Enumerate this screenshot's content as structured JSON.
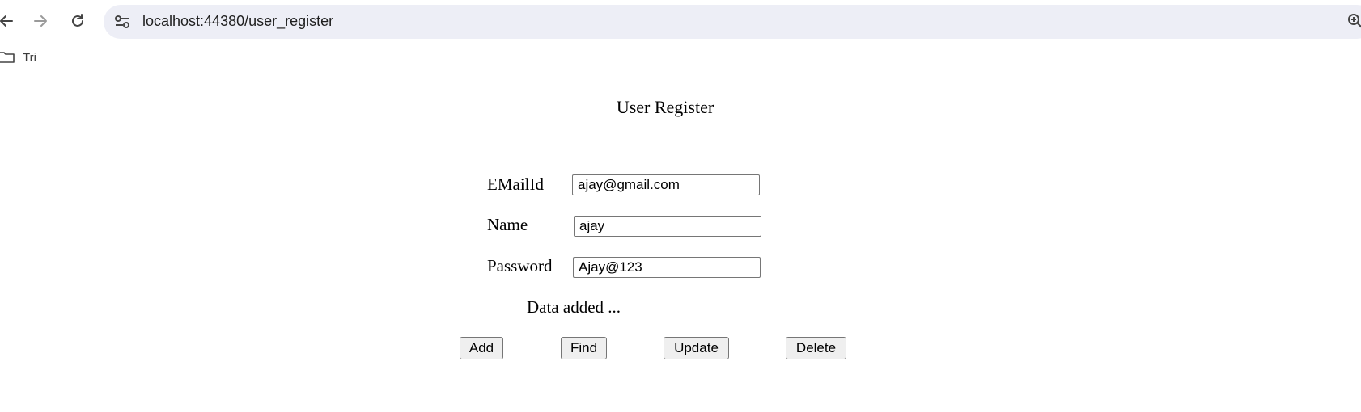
{
  "browser": {
    "url": "localhost:44380/user_register",
    "bookmark_folder": "Tri",
    "icons": {
      "back": "back-arrow-icon",
      "forward": "forward-arrow-icon",
      "reload": "reload-icon",
      "site_info": "tune-icon",
      "zoom": "zoom-icon",
      "folder": "folder-icon"
    }
  },
  "page": {
    "title": "User Register",
    "fields": {
      "email_label": "EMailId",
      "email_value": "ajay@gmail.com",
      "name_label": "Name",
      "name_value": "ajay",
      "password_label": "Password",
      "password_value": "Ajay@123"
    },
    "message": "Data added ...",
    "buttons": {
      "add": "Add",
      "find": "Find",
      "update": "Update",
      "delete": "Delete"
    }
  }
}
